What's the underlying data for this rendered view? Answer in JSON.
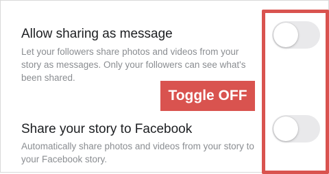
{
  "settings": [
    {
      "title": "Allow sharing as message",
      "description": "Let your followers share photos and videos from your story as messages. Only your followers can see what's been shared.",
      "toggle_on": false
    },
    {
      "title": "Share your story to Facebook",
      "description": "Automatically share photos and videos from your story to your Facebook story.",
      "toggle_on": false
    }
  ],
  "annotation": {
    "label": "Toggle OFF",
    "color": "#d9534f"
  }
}
